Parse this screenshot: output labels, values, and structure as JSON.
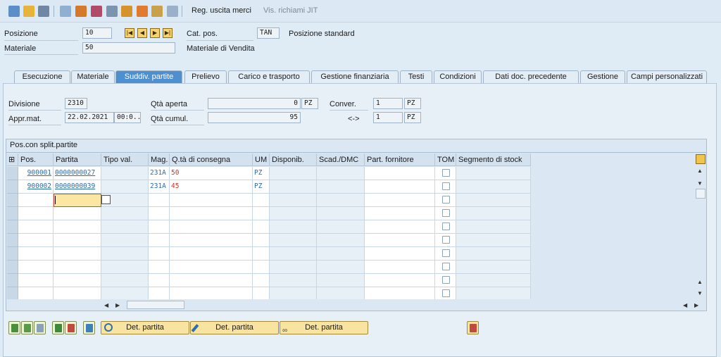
{
  "toolbar": {
    "reg_uscita": "Reg. uscita merci",
    "vis_richiami": "Vis. richiami JIT"
  },
  "header": {
    "posizione_label": "Posizione",
    "posizione_value": "10",
    "materiale_label": "Materiale",
    "materiale_value": "50",
    "cat_pos_label": "Cat. pos.",
    "cat_pos_value": "TAN",
    "cat_pos_desc": "Posizione standard",
    "materiale_desc": "Materiale di Vendita"
  },
  "tabs": [
    {
      "label": "Esecuzione"
    },
    {
      "label": "Materiale"
    },
    {
      "label": "Suddiv. partite"
    },
    {
      "label": "Prelievo"
    },
    {
      "label": "Carico e trasporto"
    },
    {
      "label": "Gestione finanziaria"
    },
    {
      "label": "Testi"
    },
    {
      "label": "Condizioni"
    },
    {
      "label": "Dati doc. precedente"
    },
    {
      "label": "Gestione"
    },
    {
      "label": "Campi personalizzati"
    }
  ],
  "details": {
    "divisione_label": "Divisione",
    "divisione_value": "2310",
    "appr_label": "Appr.mat.",
    "appr_date": "22.02.2021",
    "appr_time": "00:0...",
    "qta_aperta_label": "Qtà aperta",
    "qta_aperta_value": "0",
    "qta_aperta_unit": "PZ",
    "qta_cumul_label": "Qtà cumul.",
    "qta_cumul_value": "95",
    "conver_label": "Conver.",
    "conver_value": "1",
    "conver_unit": "PZ",
    "arrow_label": "<->",
    "conver_value2": "1",
    "conver_unit2": "PZ"
  },
  "grid": {
    "title": "Pos.con split.partite",
    "columns": [
      "Pos.",
      "Partita",
      "Tipo val.",
      "Mag.",
      "Q.tà di consegna",
      "UM",
      "Disponib.",
      "Scad./DMC",
      "Part. fornitore",
      "TOM",
      "Segmento di stock"
    ],
    "rows": [
      {
        "pos": "900001",
        "partita": "0000000027",
        "mag": "231A",
        "qta": "50",
        "um": "PZ"
      },
      {
        "pos": "900002",
        "partita": "0000000039",
        "mag": "231A",
        "qta": "45",
        "um": "PZ"
      }
    ]
  },
  "buttons": {
    "det1": "Det. partita",
    "det2": "Det. partita",
    "det3": "Det. partita"
  }
}
